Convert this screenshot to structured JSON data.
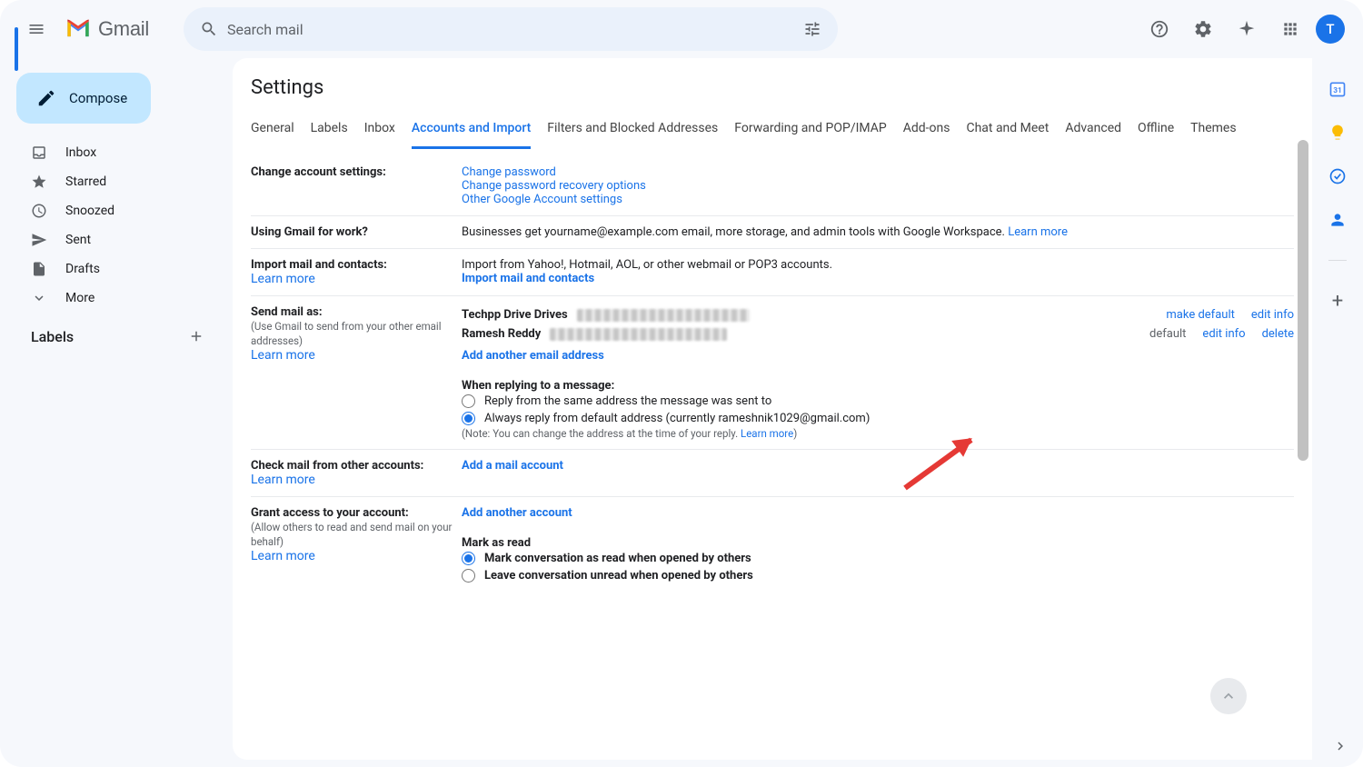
{
  "header": {
    "product_name": "Gmail",
    "search_placeholder": "Search mail",
    "avatar_initial": "T"
  },
  "sidebar": {
    "compose_label": "Compose",
    "items": [
      {
        "icon": "inbox",
        "label": "Inbox"
      },
      {
        "icon": "star",
        "label": "Starred"
      },
      {
        "icon": "clock",
        "label": "Snoozed"
      },
      {
        "icon": "send",
        "label": "Sent"
      },
      {
        "icon": "file",
        "label": "Drafts"
      },
      {
        "icon": "chevron-down",
        "label": "More"
      }
    ],
    "labels_heading": "Labels"
  },
  "settings": {
    "title": "Settings",
    "tabs": [
      "General",
      "Labels",
      "Inbox",
      "Accounts and Import",
      "Filters and Blocked Addresses",
      "Forwarding and POP/IMAP",
      "Add-ons",
      "Chat and Meet",
      "Advanced",
      "Offline",
      "Themes"
    ],
    "active_tab_index": 3,
    "sections": {
      "change_account": {
        "heading": "Change account settings:",
        "links": [
          "Change password",
          "Change password recovery options",
          "Other Google Account settings"
        ]
      },
      "work": {
        "heading": "Using Gmail for work?",
        "text": "Businesses get yourname@example.com email, more storage, and admin tools with Google Workspace. ",
        "learn_more": "Learn more"
      },
      "import": {
        "heading": "Import mail and contacts:",
        "learn_more": "Learn more",
        "text": "Import from Yahoo!, Hotmail, AOL, or other webmail or POP3 accounts.",
        "action": "Import mail and contacts"
      },
      "send_as": {
        "heading": "Send mail as:",
        "sub": "(Use Gmail to send from your other email addresses)",
        "learn_more": "Learn more",
        "rows": [
          {
            "name": "Techpp Drive Drives",
            "redacted_email": true,
            "actions": [
              "make default",
              "edit info"
            ],
            "is_default": false
          },
          {
            "name": "Ramesh Reddy",
            "redacted_email": true,
            "default_label": "default",
            "actions": [
              "edit info",
              "delete"
            ],
            "is_default": true
          }
        ],
        "add_link": "Add another email address",
        "reply_heading": "When replying to a message:",
        "reply_options": [
          "Reply from the same address the message was sent to",
          "Always reply from default address (currently rameshnik1029@gmail.com)"
        ],
        "reply_selected": 1,
        "note_prefix": "(Note: You can change the address at the time of your reply. ",
        "note_link": "Learn more",
        "note_suffix": ")"
      },
      "check_mail": {
        "heading": "Check mail from other accounts:",
        "learn_more": "Learn more",
        "action": "Add a mail account"
      },
      "grant": {
        "heading": "Grant access to your account:",
        "sub": "(Allow others to read and send mail on your behalf)",
        "learn_more": "Learn more",
        "action": "Add another account",
        "mark_heading": "Mark as read",
        "mark_options": [
          "Mark conversation as read when opened by others",
          "Leave conversation unread when opened by others"
        ],
        "mark_selected": 0
      }
    }
  }
}
